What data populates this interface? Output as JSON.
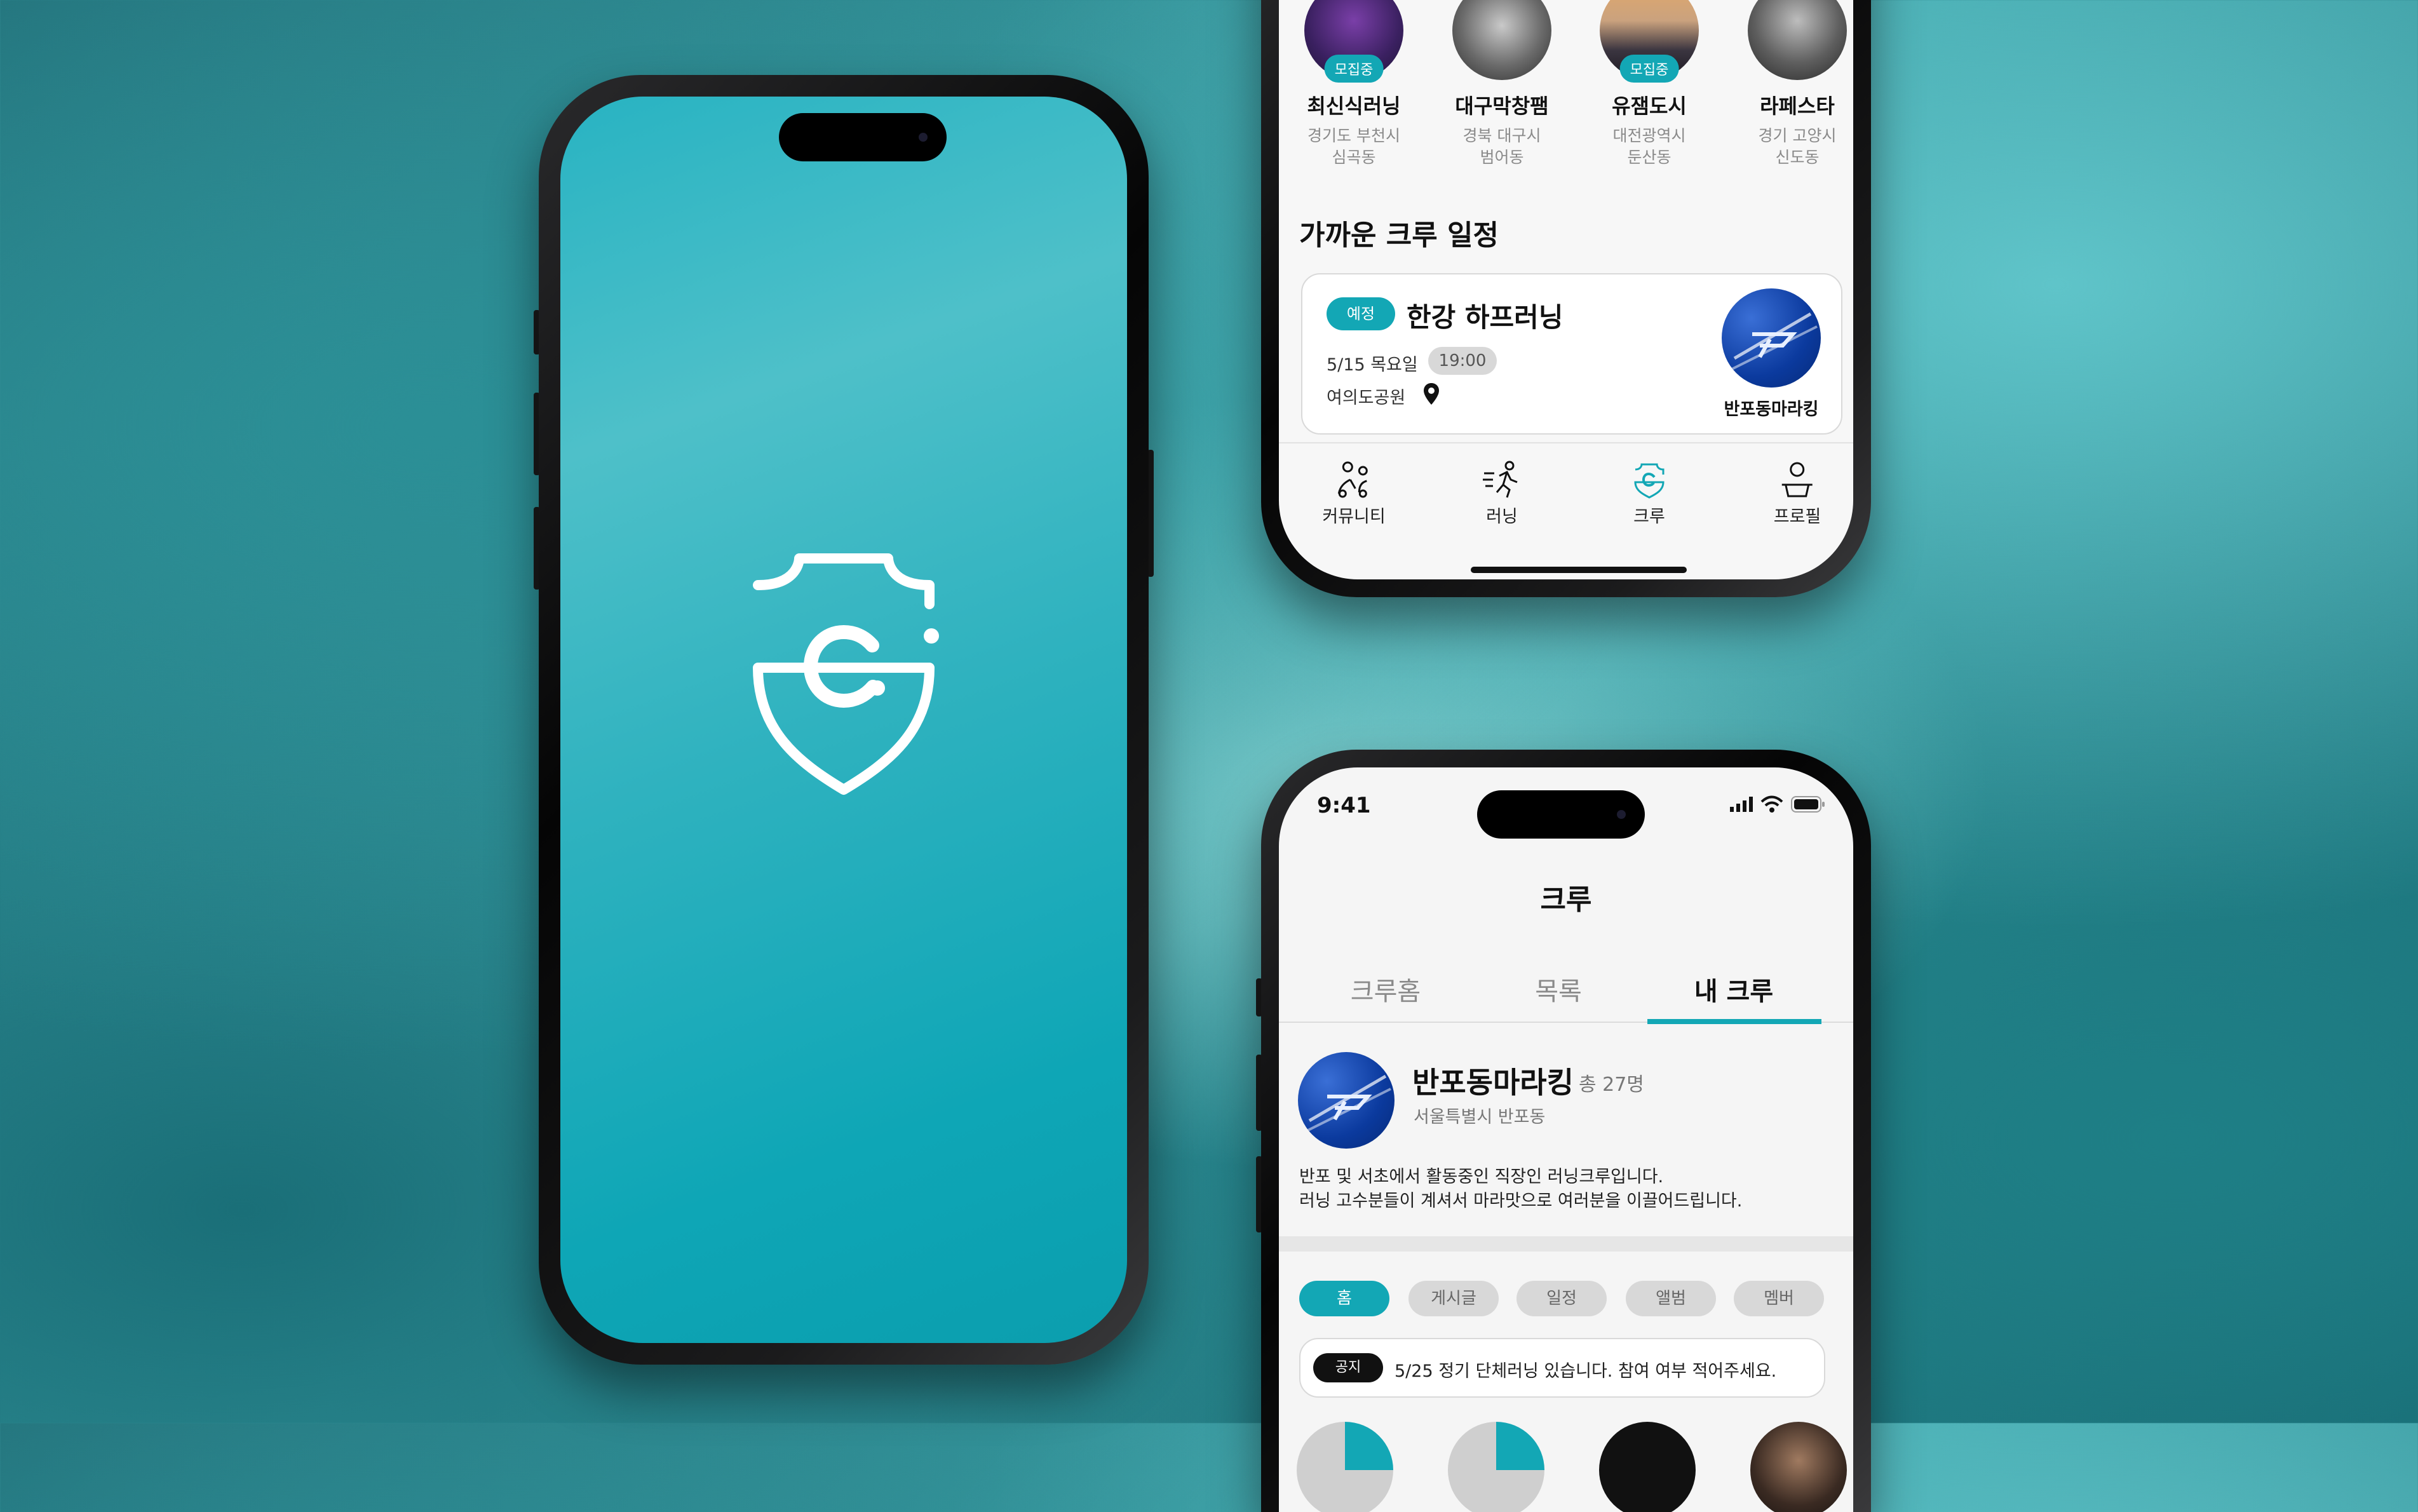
{
  "colors": {
    "accent": "#13a7b5",
    "splash_top": "#28b3c2",
    "splash_bottom": "#0b9eae"
  },
  "splash": {
    "logo": "crew-shield-logo-icon"
  },
  "top_phone": {
    "crews": [
      {
        "name": "최신식러닝",
        "region": "경기도 부천시",
        "area": "심곡동",
        "badge": "모집중"
      },
      {
        "name": "대구막창팸",
        "region": "경북 대구시",
        "area": "범어동",
        "badge": ""
      },
      {
        "name": "유잼도시",
        "region": "대전광역시",
        "area": "둔산동",
        "badge": "모집중"
      },
      {
        "name": "라페스타",
        "region": "경기 고양시",
        "area": "신도동",
        "badge": ""
      }
    ],
    "section_title": "가까운 크루 일정",
    "schedule": {
      "status": "예정",
      "title": "한강 하프러닝",
      "date": "5/15 목요일",
      "time": "19:00",
      "place": "여의도공원",
      "crew_name": "반포동마라킹"
    },
    "nav": [
      {
        "label": "커뮤니티",
        "icon": "community-icon",
        "active": false
      },
      {
        "label": "러닝",
        "icon": "running-icon",
        "active": false
      },
      {
        "label": "크루",
        "icon": "crew-icon",
        "active": true
      },
      {
        "label": "프로필",
        "icon": "profile-icon",
        "active": false
      }
    ]
  },
  "bottom_phone": {
    "status_time": "9:41",
    "page_title": "크루",
    "tabs": [
      "크루홈",
      "목록",
      "내 크루"
    ],
    "active_tab": "내 크루",
    "crew": {
      "name": "반포동마라킹",
      "members": "총 27명",
      "location": "서울특별시 반포동",
      "desc_line1": "반포 및 서초에서 활동중인 직장인 러닝크루입니다.",
      "desc_line2": "러닝 고수분들이 계셔서 마라맛으로 여러분을 이끌어드립니다."
    },
    "chips": [
      "홈",
      "게시글",
      "일정",
      "앨범",
      "멤버"
    ],
    "active_chip": "홈",
    "notice": {
      "tag": "공지",
      "text": "5/25 정기 단체러닝 있습니다. 참여 여부 적어주세요."
    }
  }
}
